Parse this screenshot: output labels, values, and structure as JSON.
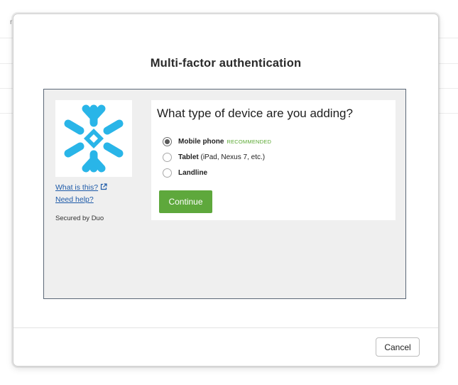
{
  "background": {
    "corner_mark": "r"
  },
  "modal": {
    "title": "Multi-factor authentication",
    "cancel_label": "Cancel"
  },
  "duo": {
    "logo_icon": "snowflake-logo-icon",
    "brand_color": "#29b5e8",
    "links": {
      "what_is_this": "What is this?",
      "need_help": "Need help?"
    },
    "secured_by": "Secured by Duo",
    "question": "What type of device are you adding?",
    "options": [
      {
        "label": "Mobile phone",
        "detail": "",
        "tag": "RECOMMENDED",
        "selected": true
      },
      {
        "label": "Tablet",
        "detail": " (iPad, Nexus 7, etc.)",
        "tag": "",
        "selected": false
      },
      {
        "label": "Landline",
        "detail": "",
        "tag": "",
        "selected": false
      }
    ],
    "continue_label": "Continue",
    "accent_color": "#5ea83c"
  }
}
